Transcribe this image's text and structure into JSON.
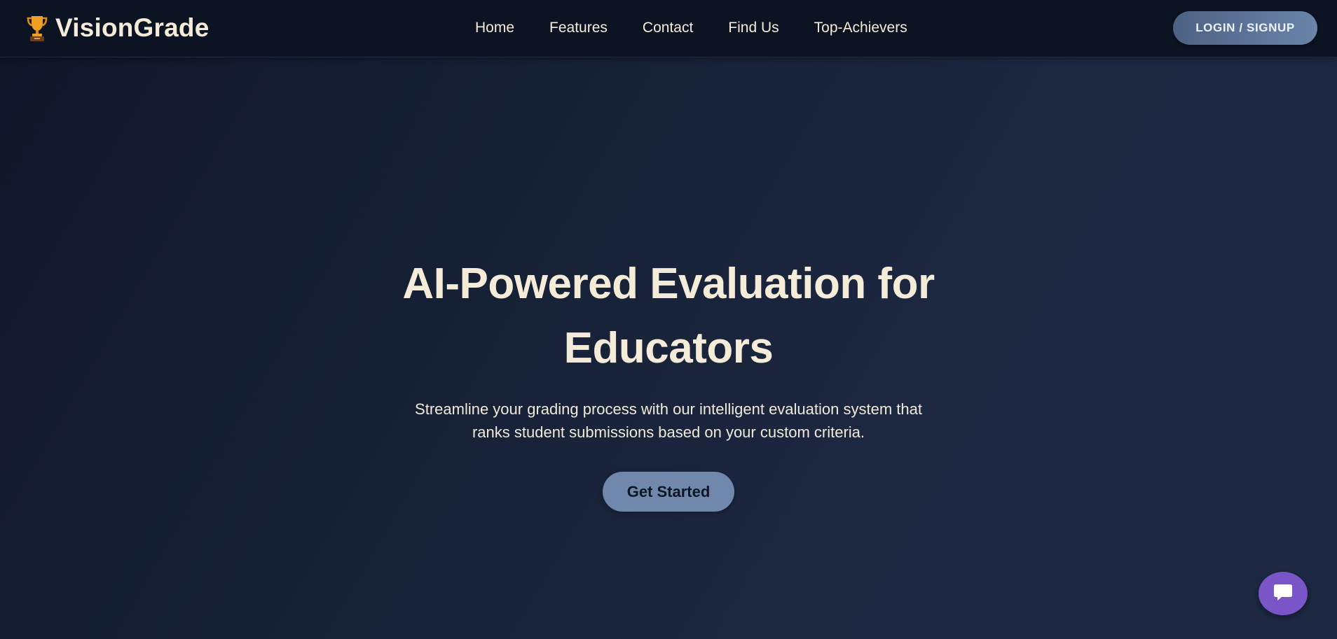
{
  "header": {
    "brand": {
      "name": "VisionGrade",
      "icon": "trophy-icon"
    },
    "nav": [
      {
        "label": "Home"
      },
      {
        "label": "Features"
      },
      {
        "label": "Contact"
      },
      {
        "label": "Find Us"
      },
      {
        "label": "Top-Achievers"
      }
    ],
    "login_label": "LOGIN / SIGNUP"
  },
  "hero": {
    "title": "AI-Powered Evaluation for Educators",
    "subtitle": "Streamline your grading process with our intelligent evaluation system that ranks student submissions based on your custom criteria.",
    "cta_label": "Get Started"
  },
  "chat_widget": {
    "icon": "chat-bubble-icon"
  },
  "colors": {
    "background": "#162034",
    "navbar": "#0c1322",
    "text_cream": "#f4ecd8",
    "button_blue": "#7088ac",
    "chat_purple": "#7a55c8"
  }
}
